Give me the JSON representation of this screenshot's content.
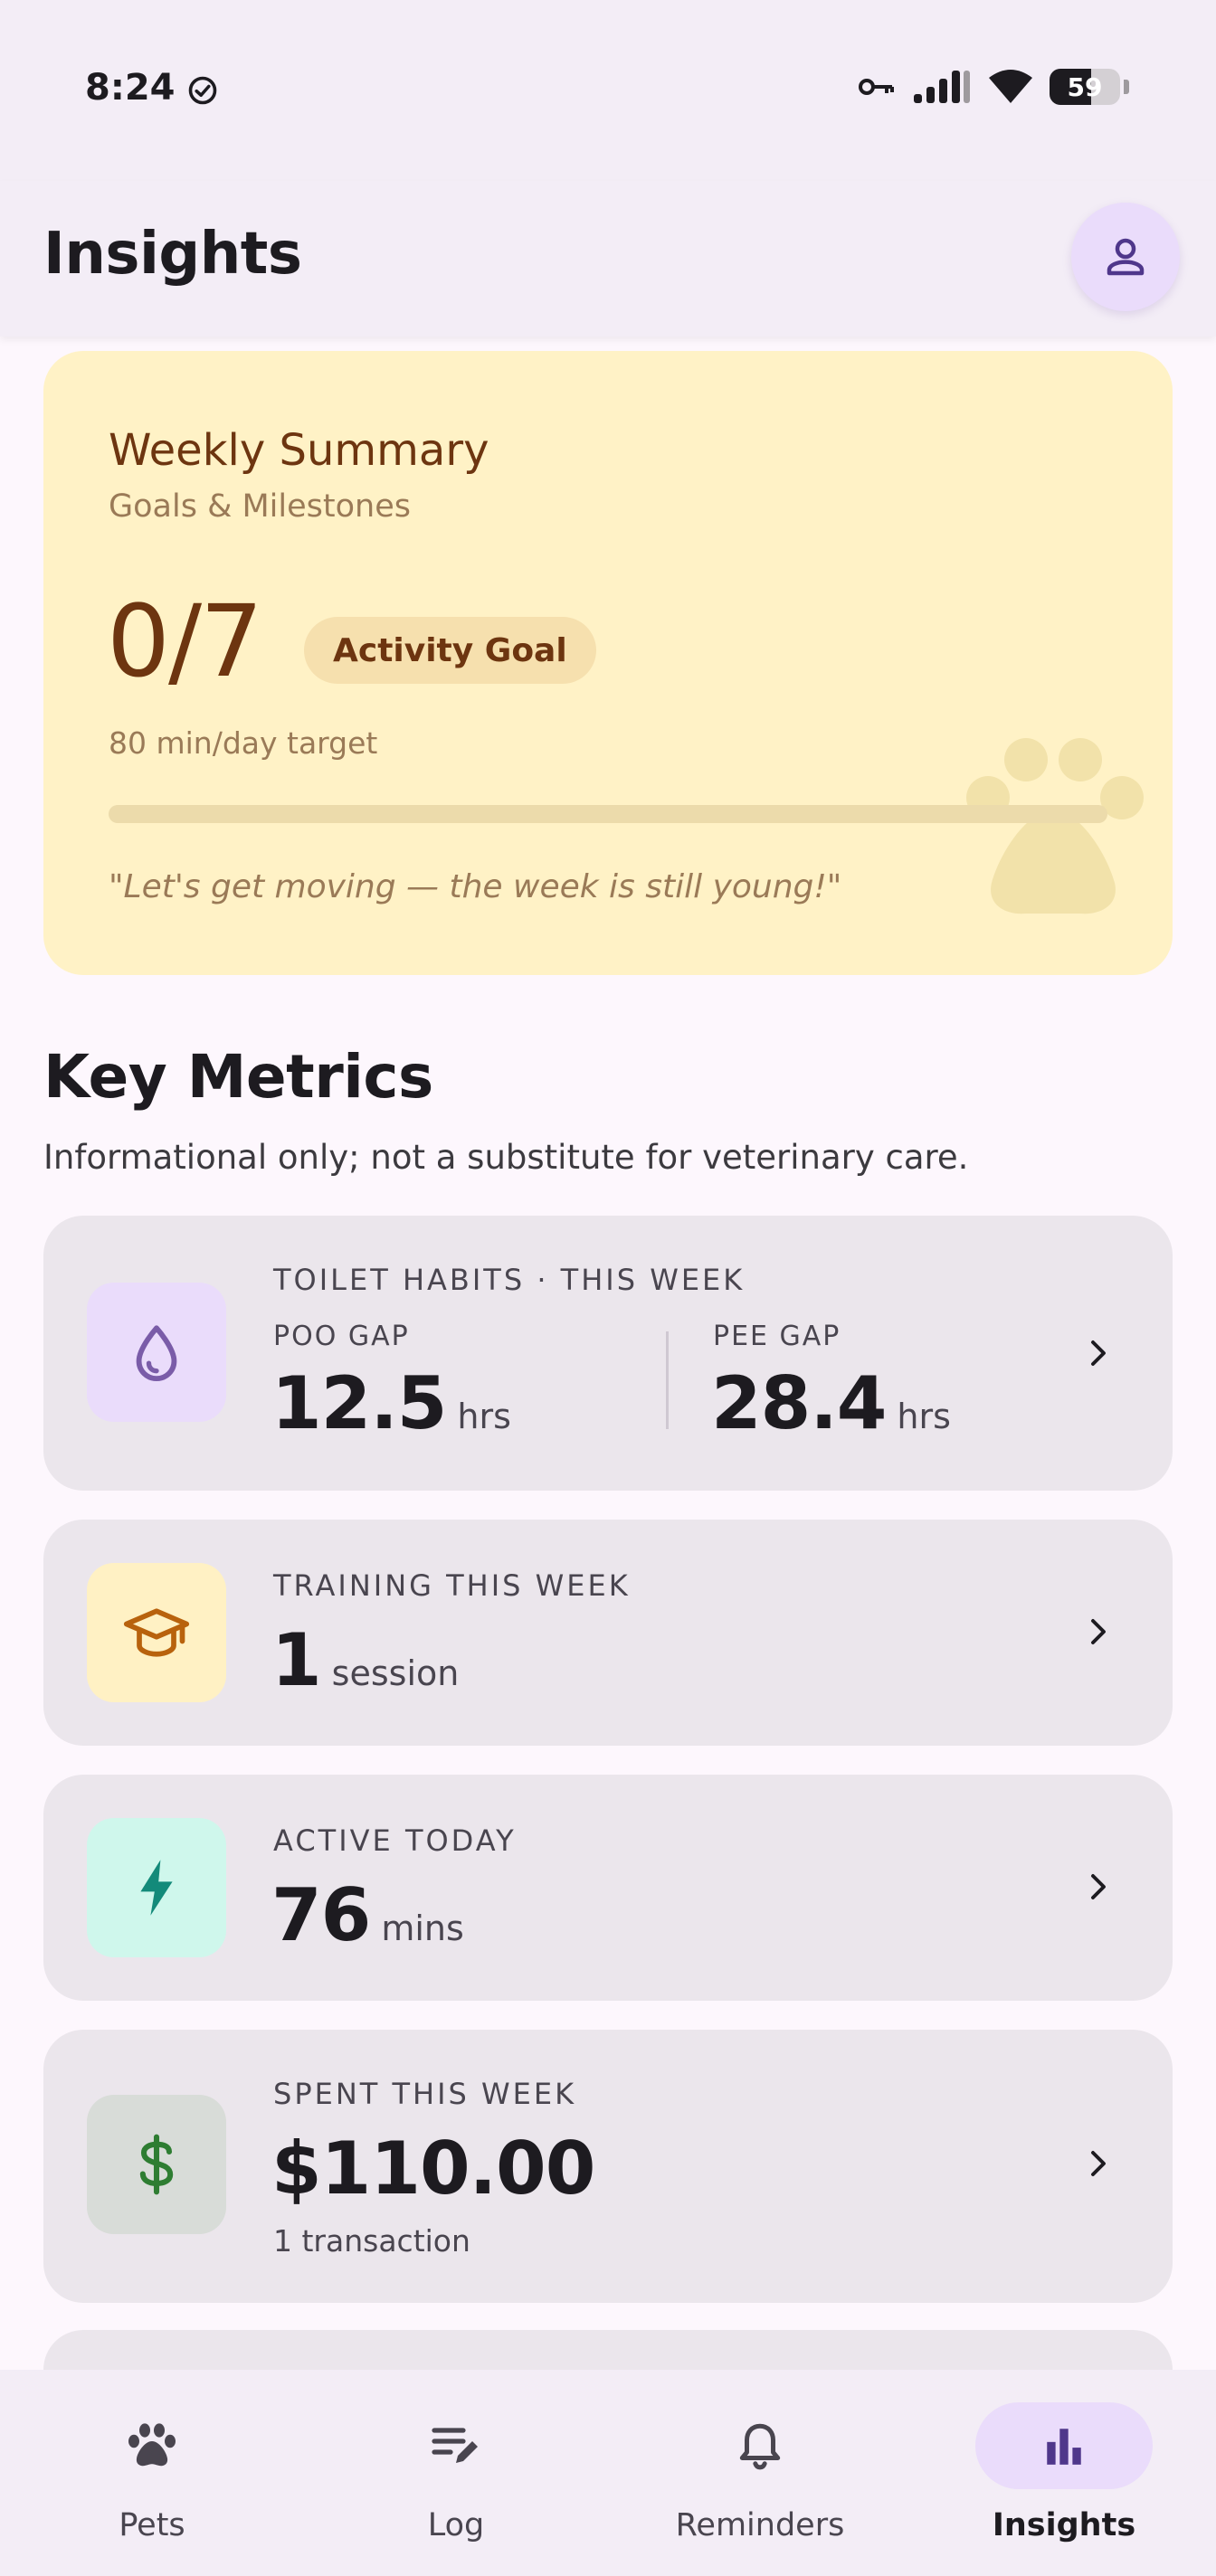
{
  "status_bar": {
    "time": "8:24",
    "battery_level": "59",
    "battery_fraction": 0.59
  },
  "header": {
    "title": "Insights",
    "profile_icon": "person-outline-icon"
  },
  "weekly_summary": {
    "title": "Weekly Summary",
    "subtitle": "Goals & Milestones",
    "goal_count": "0/7",
    "goal_chip": "Activity Goal",
    "target": "80 min/day target",
    "progress_fraction": 0,
    "quote": "\"Let's get moving — the week is still young!\"",
    "watermark_icon": "paw-icon"
  },
  "key_metrics": {
    "title": "Key Metrics",
    "disclaimer": "Informational only; not a substitute for veterinary care.",
    "toilet": {
      "label": "TOILET HABITS · THIS WEEK",
      "poo_label": "POO GAP",
      "poo_value": "12.5",
      "poo_unit": "hrs",
      "pee_label": "PEE GAP",
      "pee_value": "28.4",
      "pee_unit": "hrs",
      "icon": "water-drop-icon",
      "icon_bg": "#eadcfb",
      "icon_color": "#7a5ca8"
    },
    "training": {
      "label": "TRAINING THIS WEEK",
      "value": "1",
      "unit": "session",
      "icon": "graduation-cap-icon",
      "icon_bg": "#fff1c4",
      "icon_color": "#b8620d"
    },
    "active": {
      "label": "ACTIVE TODAY",
      "value": "76",
      "unit": "mins",
      "icon": "bolt-icon",
      "icon_bg": "#cff7ec",
      "icon_color": "#138a7a"
    },
    "spent": {
      "label": "SPENT THIS WEEK",
      "value": "$110.00",
      "sub": "1 transaction",
      "icon": "dollar-icon",
      "icon_bg": "#d8dcd8",
      "icon_color": "#2e7d32"
    }
  },
  "bottom_nav": {
    "items": [
      {
        "label": "Pets",
        "icon": "paw-icon"
      },
      {
        "label": "Log",
        "icon": "edit-note-icon"
      },
      {
        "label": "Reminders",
        "icon": "bell-icon"
      },
      {
        "label": "Insights",
        "icon": "bar-chart-icon",
        "active": true
      }
    ]
  }
}
